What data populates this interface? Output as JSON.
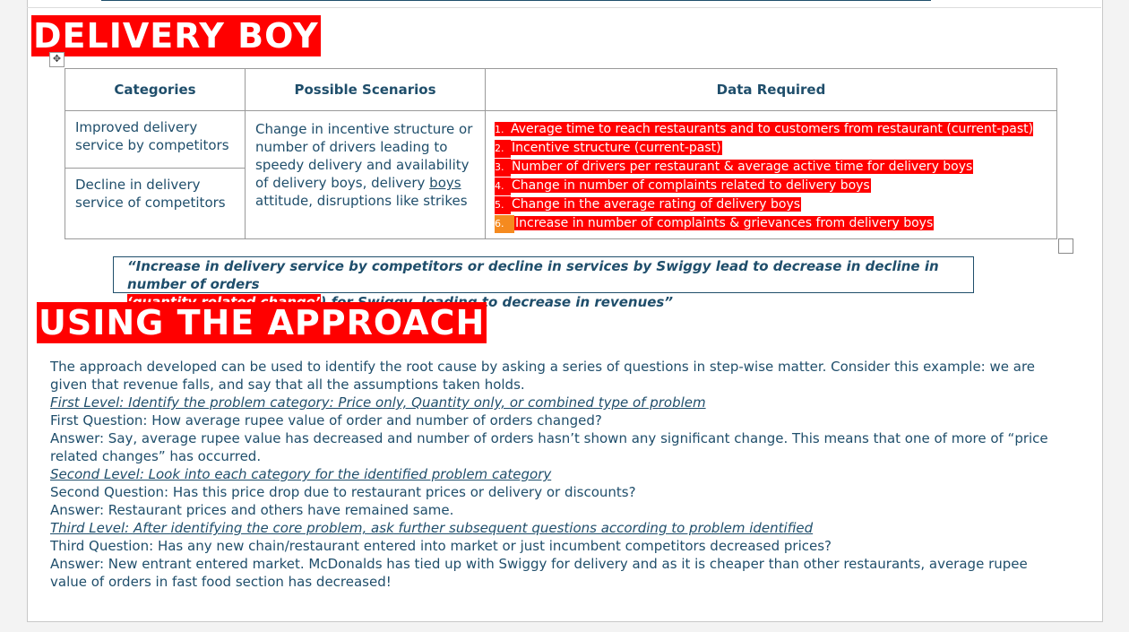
{
  "sections": {
    "delivery_heading": "DELIVERY BOY",
    "approach_heading": "USING THE  APPROACH"
  },
  "table": {
    "headers": [
      "Categories",
      "Possible Scenarios",
      "Data Required"
    ],
    "categories": [
      "Improved delivery service by competitors",
      "Decline in delivery service of competitors"
    ],
    "scenario_text": "Change in incentive structure or number of drivers leading to speedy delivery and availability of delivery boys, delivery ",
    "scenario_underlined": "boys",
    "scenario_tail": " attitude, disruptions like strikes",
    "data_required": [
      {
        "num": "1.",
        "text": "Average time to reach restaurants and to customers from restaurant (current-past)"
      },
      {
        "num": "2.",
        "text": "Incentive  structure  (current-past)"
      },
      {
        "num": "3.",
        "text": "Number of drivers per restaurant & average active time for delivery boys"
      },
      {
        "num": "4.",
        "text": "Change in number of complaints related to delivery boys"
      },
      {
        "num": "5.",
        "text": "Change in the average rating of delivery boys"
      },
      {
        "num": "6.",
        "text": "Increase in number of complaints & grievances from delivery boys"
      }
    ]
  },
  "quote": {
    "line1": "“Increase in delivery service by competitors or decline in services by Swiggy lead to decrease in decline in number of orders",
    "highlight": "‘quantity related change’",
    "line2_tail": ") for Swiggy, leading to decrease in revenues”"
  },
  "body": {
    "intro": "The approach developed can be used to identify the root cause by asking a series of questions in step-wise matter. Consider this example: we are given that revenue falls, and say that all the assumptions taken holds.",
    "level1": "First Level: Identify the problem category: Price only, Quantity only, or combined type of problem",
    "q1": "First Question: How average rupee value of order and number of orders changed?",
    "a1": "Answer: Say, average rupee value has decreased and number of orders hasn’t shown any significant change. This means that one of more of “price related changes” has occurred.",
    "level2": "Second Level: Look into each category for the identified problem category",
    "q2": "Second Question: Has this price drop due to restaurant prices or delivery or discounts?",
    "a2": "Answer: Restaurant prices and others have remained same.",
    "level3": "Third Level: After identifying the core problem, ask further subsequent questions according to problem identified",
    "q3": "Third Question: Has any new chain/restaurant entered into market or just incumbent competitors decreased prices?",
    "a3": "Answer: New entrant entered market. McDonalds has tied up with Swiggy for delivery and as it is cheaper than other restaurants, average rupee value of orders in fast food section has decreased!"
  },
  "colors": {
    "heading_bg": "#ff0000",
    "text": "#1f4e6b",
    "highlight_orange": "#f58a1f"
  }
}
